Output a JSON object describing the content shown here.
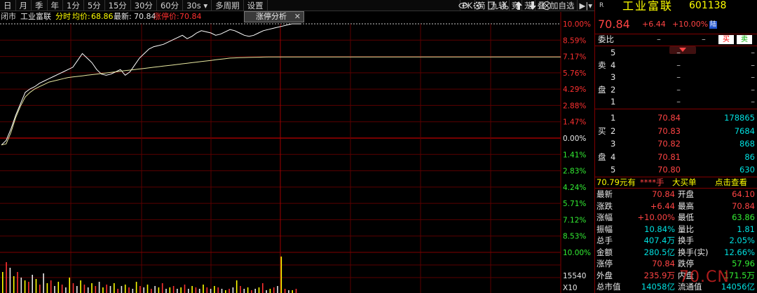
{
  "toolbar": {
    "periods": [
      "日",
      "月",
      "季",
      "年",
      "1分",
      "5分",
      "15分",
      "30分",
      "60分",
      "30s ▾",
      "多周期",
      "设置"
    ],
    "right_tools": [
      "PK",
      "简",
      "九转",
      "竞",
      "茏",
      "叠",
      "加自选",
      "▶|▾"
    ],
    "icons": [
      "eye-icon",
      "gear-icon",
      "delete-icon",
      "scissors-icon",
      "up-arrow-icon",
      "down-arrow-icon",
      "close-circle-icon"
    ]
  },
  "info": {
    "status": "闭市",
    "name": "工业富联",
    "minute_label": "分时",
    "avg_label": "均价:",
    "avg_value": "68.86",
    "latest_label": "最新:",
    "latest_value": "70.84",
    "limit_label": "涨停价:",
    "limit_value": "70.84",
    "tab_label": "涨停分析",
    "tab_close": "✕"
  },
  "axis": {
    "upper_pct": [
      "10.00%",
      "8.59%",
      "7.17%",
      "5.76%",
      "4.29%",
      "2.88%",
      "1.47%",
      "0.00%",
      "1.41%",
      "2.83%",
      "4.24%",
      "5.71%",
      "7.12%",
      "8.53%",
      "10.00%"
    ],
    "vol_labels": [
      "15540",
      "X10"
    ]
  },
  "chart_data": {
    "type": "line",
    "prev_close": 64.4,
    "y_pct_range": [
      -10.0,
      10.0
    ],
    "series": [
      {
        "values_pct": [
          -0.6,
          -0.2,
          0.8,
          2.0,
          3.0,
          4.0,
          4.3,
          4.5,
          4.8,
          5.0,
          5.2,
          5.4,
          5.6,
          5.8,
          6.0,
          6.2,
          6.8,
          7.4,
          7.0,
          6.6,
          6.0,
          5.6,
          5.5,
          5.6,
          5.8,
          6.0,
          5.5,
          5.8,
          6.4,
          7.0,
          7.4,
          7.8,
          8.0,
          8.1,
          8.2,
          8.4,
          8.6,
          8.8,
          9.0,
          8.7,
          8.9,
          9.2,
          9.4,
          9.3,
          9.2,
          9.0,
          9.1,
          9.3,
          9.5,
          9.4,
          9.2,
          9.0,
          8.9,
          9.0,
          9.2,
          9.4,
          9.5,
          9.6,
          9.7,
          9.8,
          9.9,
          10.0,
          10.0,
          10.0
        ],
        "color": "#ffffff"
      },
      {
        "values_pct": [
          -0.6,
          -0.5,
          0.5,
          1.8,
          2.8,
          3.6,
          4.0,
          4.3,
          4.5,
          4.7,
          4.9,
          5.0,
          5.1,
          5.2,
          5.3,
          5.35,
          5.4,
          5.45,
          5.5,
          5.55,
          5.6,
          5.65,
          5.7,
          5.75,
          5.8,
          5.85,
          5.9,
          5.95,
          6.0,
          6.05,
          6.1,
          6.15,
          6.2,
          6.25,
          6.3,
          6.35,
          6.4,
          6.45,
          6.5,
          6.55,
          6.6,
          6.65,
          6.7,
          6.75,
          6.8,
          6.85,
          6.9,
          6.95,
          7.0,
          7.02,
          7.04,
          7.05,
          7.06,
          7.07,
          7.08,
          7.09,
          7.1,
          7.1,
          7.1,
          7.1,
          7.1,
          7.1,
          7.1,
          7.1
        ],
        "color": "#e8e8a0"
      }
    ]
  },
  "panel": {
    "flag": "R",
    "name": "工业富联",
    "code": "601138",
    "price": "70.84",
    "change": "+6.44",
    "change_pct": "+10.00%",
    "market_tag": "陆",
    "weibi_label": "委比",
    "weibi_val1": "–",
    "weibi_val2": "–",
    "buy_btn": "买",
    "sell_btn": "卖",
    "sell_side_label": "卖盘",
    "buy_side_label": "买盘",
    "sell": [
      {
        "lvl": "5",
        "price": "–",
        "vol": "–"
      },
      {
        "lvl": "4",
        "price": "–",
        "vol": "–"
      },
      {
        "lvl": "3",
        "price": "–",
        "vol": "–"
      },
      {
        "lvl": "2",
        "price": "–",
        "vol": "–"
      },
      {
        "lvl": "1",
        "price": "–",
        "vol": "–"
      }
    ],
    "buy": [
      {
        "lvl": "1",
        "price": "70.84",
        "vol": "178865"
      },
      {
        "lvl": "2",
        "price": "70.83",
        "vol": "7684"
      },
      {
        "lvl": "3",
        "price": "70.82",
        "vol": "868"
      },
      {
        "lvl": "4",
        "price": "70.81",
        "vol": "86"
      },
      {
        "lvl": "5",
        "price": "70.80",
        "vol": "630"
      }
    ],
    "bigorder": {
      "price": "70.79元有",
      "qty": "****手",
      "label": "大买单",
      "link": "点击查看"
    },
    "stats": [
      {
        "l1": "最新",
        "v1": "70.84",
        "l2": "开盘",
        "v2": "64.10"
      },
      {
        "l1": "涨跌",
        "v1": "+6.44",
        "l2": "最高",
        "v2": "70.84"
      },
      {
        "l1": "涨幅",
        "v1": "+10.00%",
        "l2": "最低",
        "v2": "63.86"
      },
      {
        "l1": "振幅",
        "v1": "10.84%",
        "l2": "量比",
        "v2": "1.81"
      },
      {
        "l1": "总手",
        "v1": "407.4万",
        "l2": "换手",
        "v2": "2.05%"
      },
      {
        "l1": "金额",
        "v1": "280.5亿",
        "l2": "换手(实)",
        "v2": "12.66%"
      },
      {
        "l1": "涨停",
        "v1": "70.84",
        "l2": "跌停",
        "v2": "57.96"
      },
      {
        "l1": "外盘",
        "v1": "235.9万",
        "l2": "内盘",
        "v2": "171.5万"
      },
      {
        "l1": "总市值",
        "v1": "14058亿",
        "l2": "流通值",
        "v2": "14056亿"
      }
    ],
    "watermark": "70.CN"
  }
}
